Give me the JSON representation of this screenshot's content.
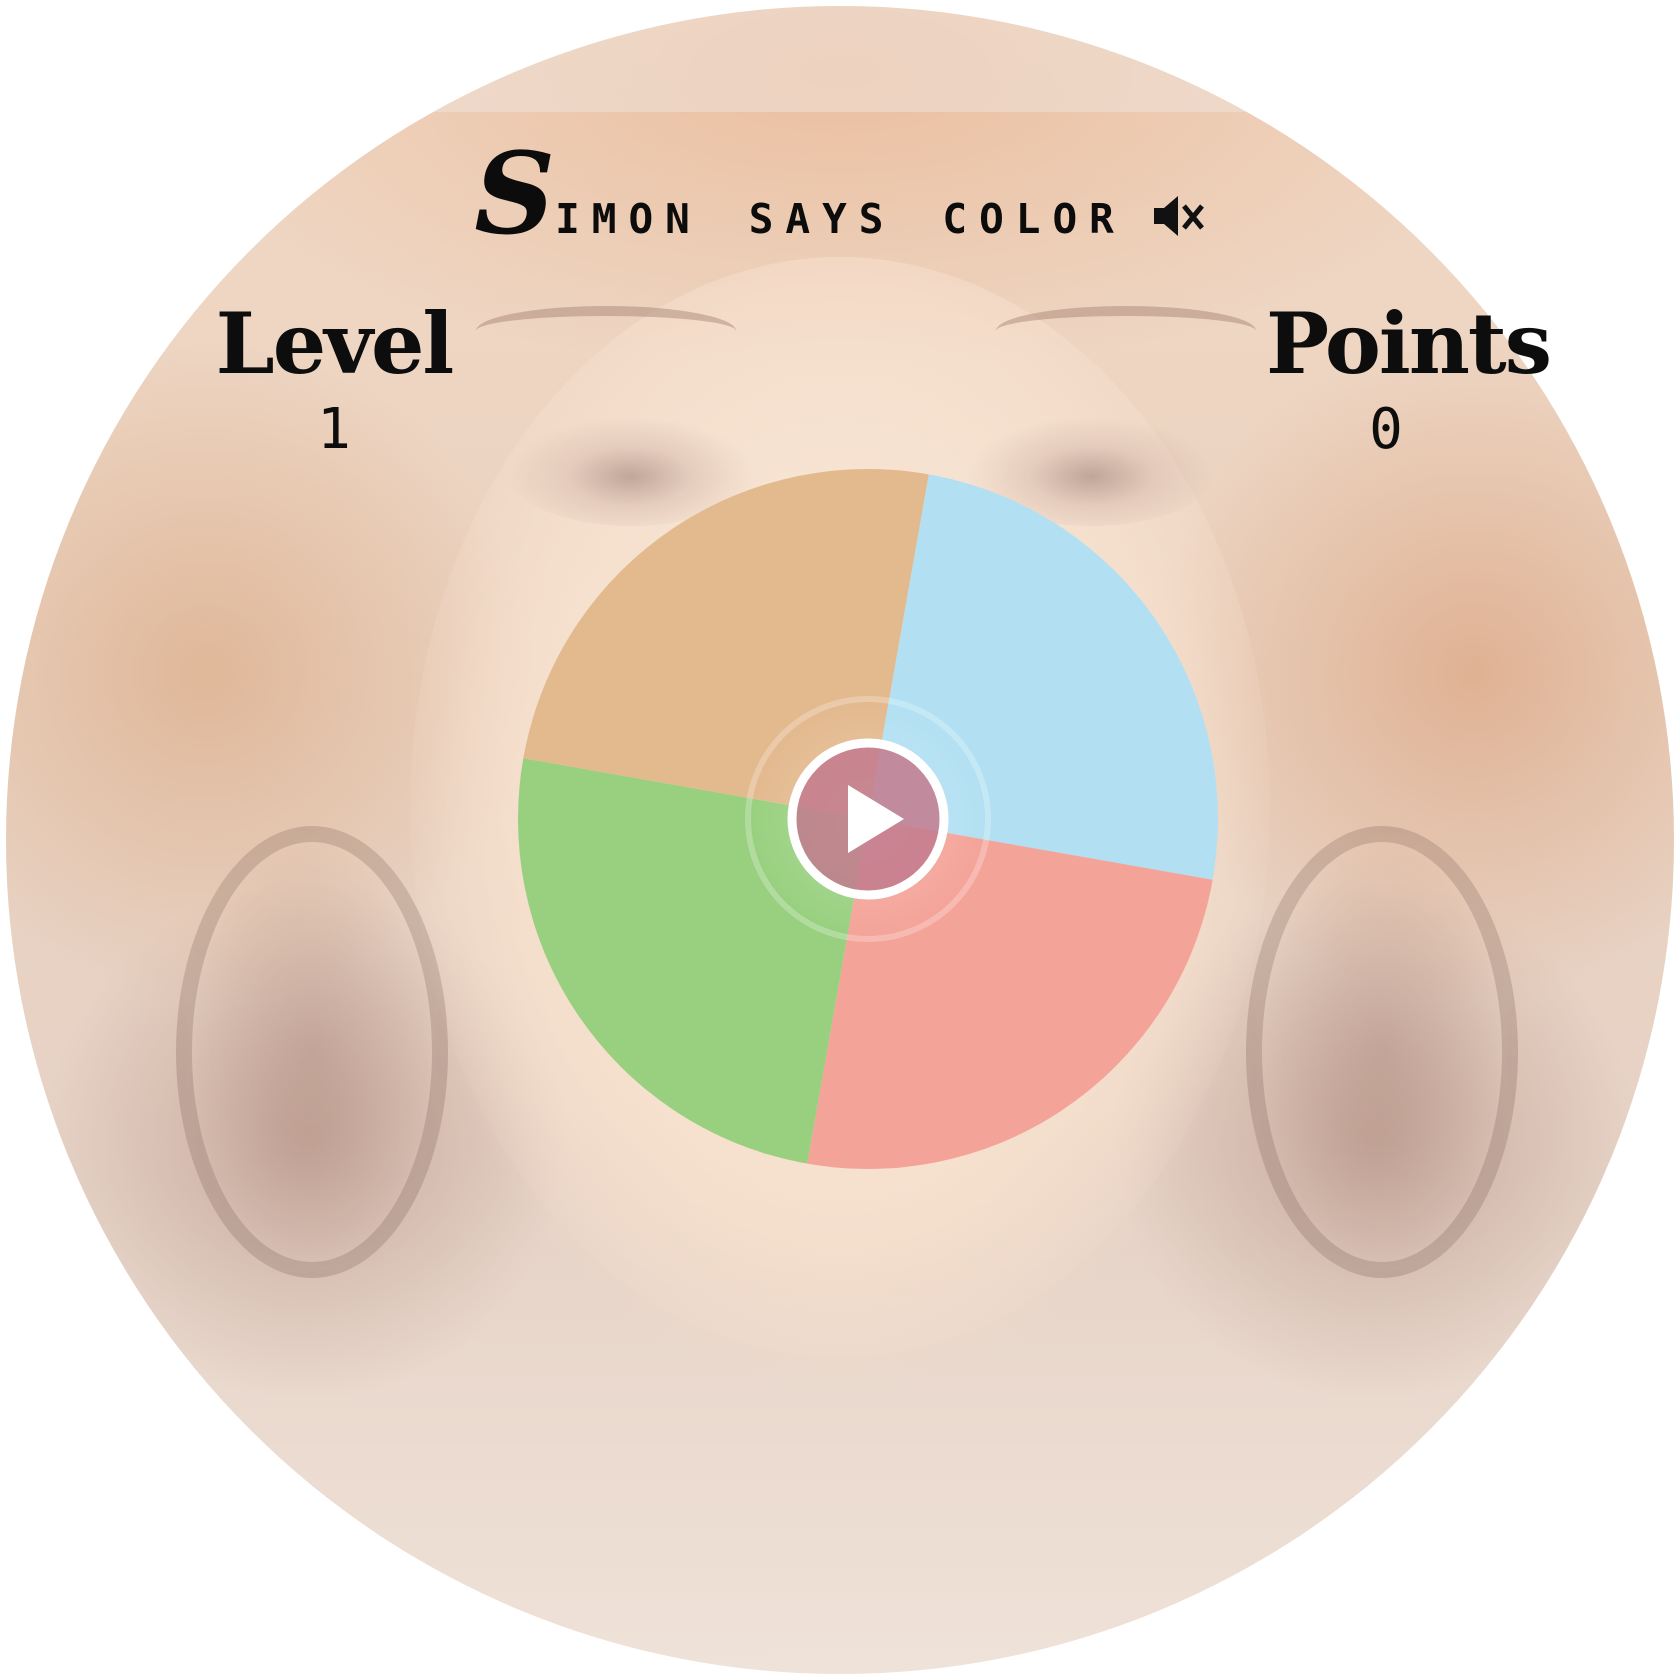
{
  "game": {
    "title_initial": "S",
    "title_rest": "imon says color",
    "sound": {
      "state": "muted",
      "icon": "speaker-muted-icon"
    }
  },
  "stats": {
    "level_label": "Level",
    "level_value": "1",
    "points_label": "Points",
    "points_value": "0"
  },
  "board": {
    "quadrants": [
      {
        "id": "blue",
        "color": "#b2e0f2"
      },
      {
        "id": "red",
        "color": "#f4a398"
      },
      {
        "id": "green",
        "color": "#98d07f"
      },
      {
        "id": "orange",
        "color": "#e3b98e"
      }
    ],
    "play_button": {
      "icon": "play-icon",
      "color": "#c27a8d"
    }
  }
}
